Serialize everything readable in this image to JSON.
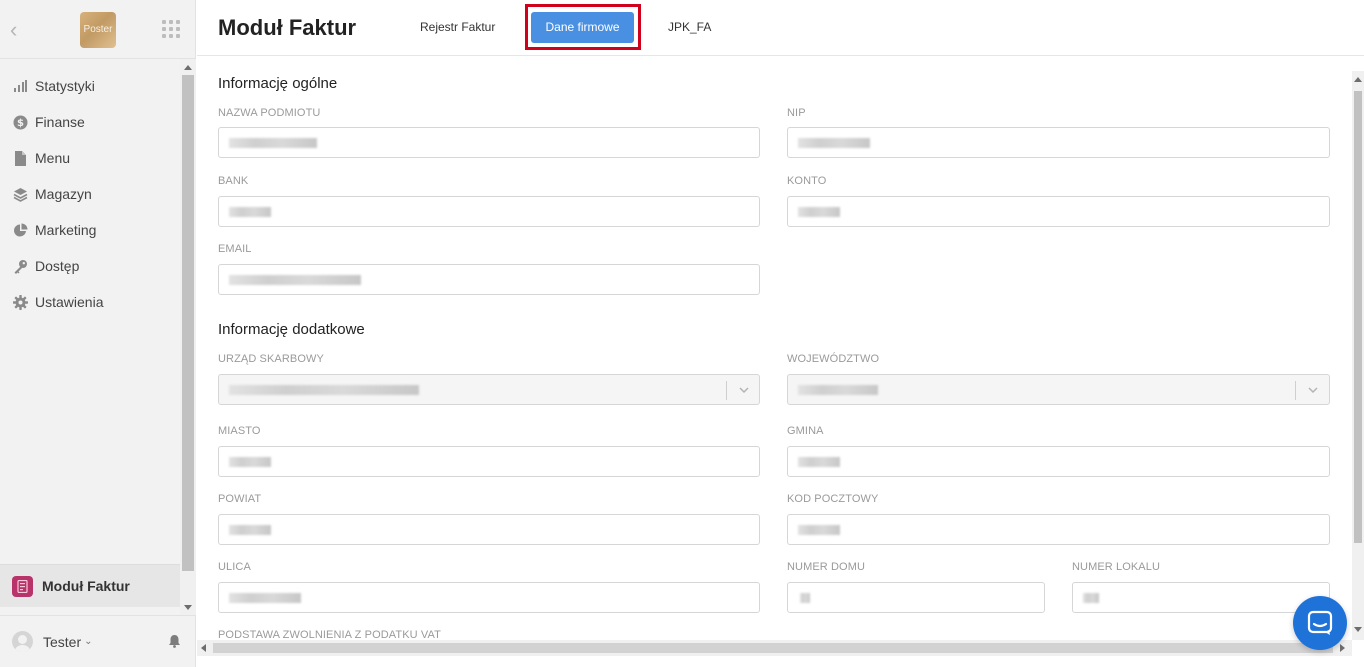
{
  "sidebar": {
    "logo_text": "Poster",
    "items": [
      {
        "label": "Statystyki",
        "icon": "bar-chart-icon"
      },
      {
        "label": "Finanse",
        "icon": "dollar-circle-icon"
      },
      {
        "label": "Menu",
        "icon": "document-icon"
      },
      {
        "label": "Magazyn",
        "icon": "layers-icon"
      },
      {
        "label": "Marketing",
        "icon": "pie-chart-icon"
      },
      {
        "label": "Dostęp",
        "icon": "key-icon"
      },
      {
        "label": "Ustawienia",
        "icon": "gear-icon"
      }
    ],
    "active_app": "Moduł Faktur",
    "user": "Tester"
  },
  "header": {
    "title": "Moduł Faktur",
    "tabs": {
      "rejestr": "Rejestr Faktur",
      "dane": "Dane firmowe",
      "jpk": "JPK_FA"
    }
  },
  "form": {
    "general_title": "Informację ogólne",
    "nazwa_label": "NAZWA PODMIOTU",
    "nip_label": "NIP",
    "bank_label": "BANK",
    "konto_label": "KONTO",
    "email_label": "EMAIL",
    "extra_title": "Informację dodatkowe",
    "urzad_label": "URZĄD SKARBOWY",
    "woj_label": "WOJEWÓDZTWO",
    "miasto_label": "MIASTO",
    "gmina_label": "GMINA",
    "powiat_label": "POWIAT",
    "kod_label": "KOD POCZTOWY",
    "ulica_label": "ULICA",
    "numer_domu_label": "NUMER DOMU",
    "numer_lokalu_label": "NUMER LOKALU",
    "vat_label": "PODSTAWA ZWOLNIENIA Z PODATKU VAT"
  },
  "colors": {
    "accent": "#4a90e2",
    "highlight": "#d0021b",
    "chat": "#1f73d8",
    "app_icon": "#b8336a"
  }
}
